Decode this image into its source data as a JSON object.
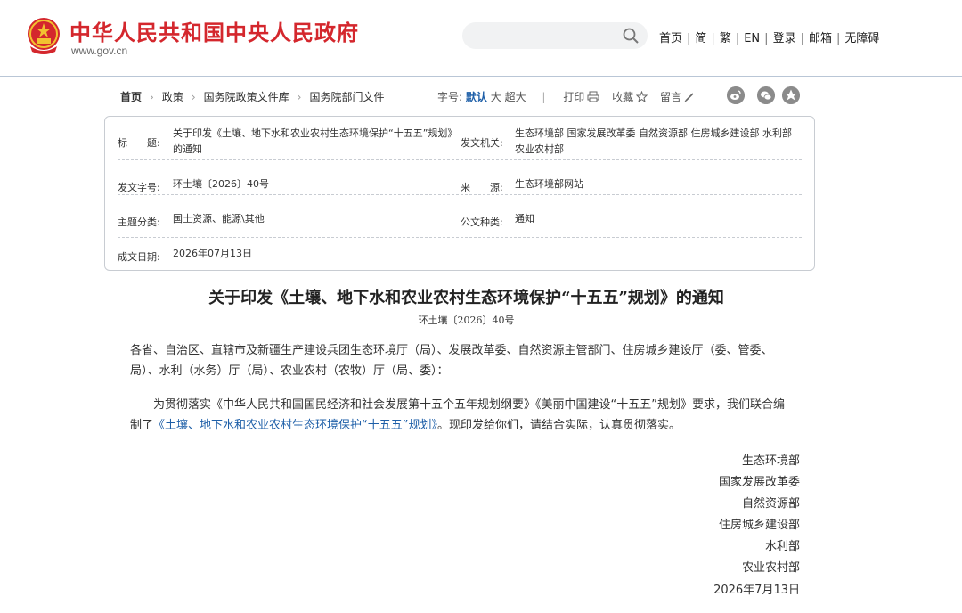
{
  "header": {
    "site_title": "中华人民共和国中央人民政府",
    "site_url": "www.gov.cn",
    "nav": [
      "首页",
      "简",
      "繁",
      "EN",
      "登录",
      "邮箱",
      "无障碍"
    ]
  },
  "breadcrumb": [
    "首页",
    "政策",
    "国务院政策文件库",
    "国务院部门文件"
  ],
  "toolbar": {
    "font_size_label": "字号:",
    "font_sizes": [
      "默认",
      "大",
      "超大"
    ],
    "active_font_size": "默认",
    "print_label": "打印",
    "favorite_label": "收藏",
    "comment_label": "留言"
  },
  "meta": {
    "title_label": "标　　题:",
    "title_value": "关于印发《土壤、地下水和农业农村生态环境保护“十五五”规划》的通知",
    "issuer_label": "发文机关:",
    "issuer_value": "生态环境部 国家发展改革委 自然资源部 住房城乡建设部 水利部 农业农村部",
    "doc_no_label": "发文字号:",
    "doc_no_value": "环土壤〔2026〕40号",
    "source_label": "来　　源:",
    "source_value": "生态环境部网站",
    "category_label": "主题分类:",
    "category_value": "国土资源、能源\\其他",
    "doc_type_label": "公文种类:",
    "doc_type_value": "通知",
    "date_label": "成文日期:",
    "date_value": "2026年07月13日"
  },
  "article": {
    "title": "关于印发《土壤、地下水和农业农村生态环境保护“十五五”规划》的通知",
    "doc_no": "环土壤〔2026〕40号",
    "recipients_line1": "各省、自治区、直辖市及新疆生产建设兵团生态环境厅（局）、发展改革委、自然资源主管部门、住房城乡建设厅（委、管委、",
    "recipients_line2": "局）、水利（水务）厅（局）、农业农村（农牧）厅（局、委）：",
    "body_line1": "为贯彻落实《中华人民共和国国民经济和社会发展第十五个五年规划纲要》《美丽中国建设“十五五”规划》要求，我们联合编",
    "body_prefix": "制了",
    "body_link": "《土壤、地下水和农业农村生态环境保护“十五五”规划》",
    "body_suffix": "。现印发给你们，请结合实际，认真贯彻落实。",
    "signatures": [
      "生态环境部",
      "国家发展改革委",
      "自然资源部",
      "住房城乡建设部",
      "水利部",
      "农业农村部"
    ],
    "sign_date": "2026年7月13日"
  },
  "colors": {
    "brand_red": "#d4272d",
    "link_blue": "#1e5fa8",
    "border": "#c8ccd2"
  },
  "icons": [
    "national-emblem-icon",
    "search-icon",
    "print-icon",
    "star-icon",
    "pen-icon",
    "weibo-icon",
    "wechat-icon",
    "qzone-icon"
  ]
}
